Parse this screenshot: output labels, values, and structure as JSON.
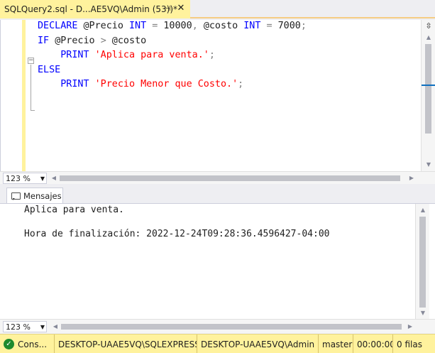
{
  "document_tab": {
    "title": "SQLQuery2.sql - D...AE5VQ\\Admin (53))*",
    "pin_glyph": "⊣",
    "close_glyph": "✕"
  },
  "editor": {
    "lines": [
      [
        {
          "t": "DECLARE ",
          "c": "kw"
        },
        {
          "t": "@Precio ",
          "c": "var"
        },
        {
          "t": "INT",
          "c": "kw"
        },
        {
          "t": " = ",
          "c": "op"
        },
        {
          "t": "10000",
          "c": "var"
        },
        {
          "t": ", ",
          "c": "op"
        },
        {
          "t": "@costo ",
          "c": "var"
        },
        {
          "t": "INT",
          "c": "kw"
        },
        {
          "t": " = ",
          "c": "op"
        },
        {
          "t": "7000",
          "c": "var"
        },
        {
          "t": ";",
          "c": "op"
        }
      ],
      [
        {
          "t": "IF ",
          "c": "kw"
        },
        {
          "t": "@Precio ",
          "c": "var"
        },
        {
          "t": ">",
          "c": "op"
        },
        {
          "t": " @costo",
          "c": "var"
        }
      ],
      [
        {
          "t": "    PRINT ",
          "c": "kw"
        },
        {
          "t": "'Aplica para venta.'",
          "c": "str"
        },
        {
          "t": ";",
          "c": "op"
        }
      ],
      [
        {
          "t": "ELSE",
          "c": "kw"
        }
      ],
      [
        {
          "t": "    PRINT ",
          "c": "kw"
        },
        {
          "t": "'Precio Menor que Costo.'",
          "c": "str"
        },
        {
          "t": ";",
          "c": "op"
        }
      ]
    ],
    "fold_glyph": "−",
    "split_glyph": "⇳",
    "zoom": "123 %"
  },
  "results": {
    "tab_label": "Mensajes",
    "messages": [
      "Aplica para venta.",
      "",
      "Hora de finalización: 2022-12-24T09:28:36.4596427-04:00"
    ],
    "zoom": "123 %"
  },
  "statusbar": {
    "status": "Cons...",
    "server": "DESKTOP-UAAE5VQ\\SQLEXPRESS ...",
    "user": "DESKTOP-UAAE5VQ\\Admin ...",
    "database": "master",
    "elapsed": "00:00:00",
    "rows": "0 filas"
  },
  "colors": {
    "keyword": "#0000ff",
    "string": "#ff0000",
    "operator": "#808080",
    "statusbar_bg": "#fff29d",
    "active_tab_bg": "#fff29d"
  }
}
